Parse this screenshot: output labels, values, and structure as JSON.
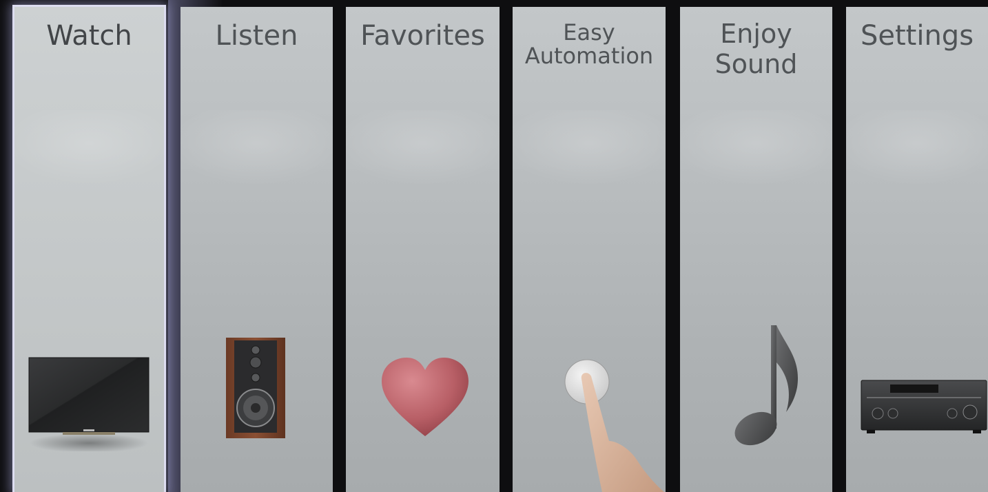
{
  "menu": {
    "items": [
      {
        "label_lines": [
          "Watch"
        ],
        "icon": "tv-icon",
        "selected": true
      },
      {
        "label_lines": [
          "Listen"
        ],
        "icon": "speaker-icon",
        "selected": false
      },
      {
        "label_lines": [
          "Favorites"
        ],
        "icon": "heart-icon",
        "selected": false
      },
      {
        "label_lines": [
          "Easy",
          "Automation"
        ],
        "icon": "button-press-icon",
        "selected": false
      },
      {
        "label_lines": [
          "Enjoy",
          "Sound"
        ],
        "icon": "music-note-icon",
        "selected": false
      },
      {
        "label_lines": [
          "Settings"
        ],
        "icon": "receiver-icon",
        "selected": false
      }
    ]
  },
  "colors": {
    "background": "#0e0e10",
    "panel": "#b9bdbf",
    "label": "#4f5356",
    "selection_glow": "#dcdcf0"
  }
}
